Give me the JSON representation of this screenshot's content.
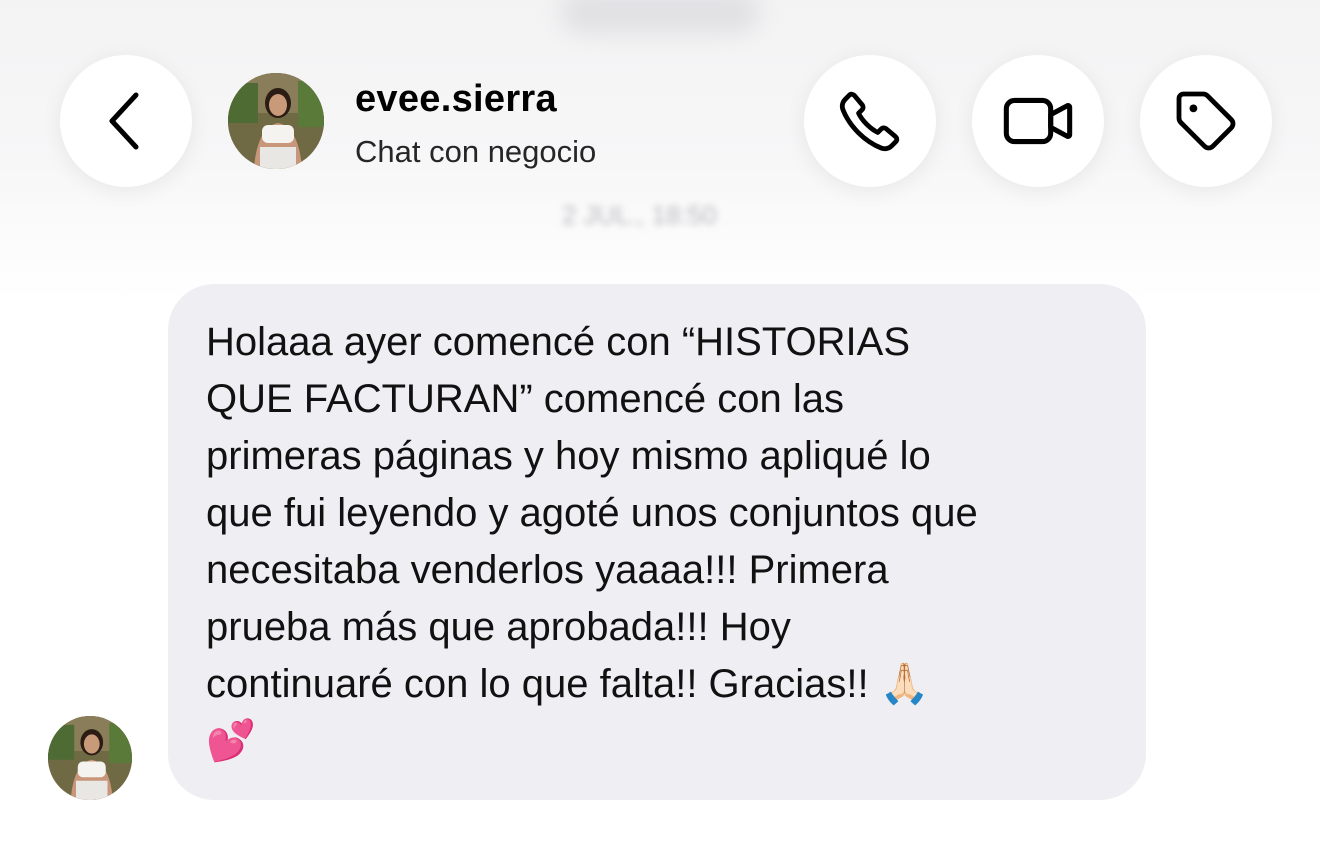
{
  "header": {
    "username": "evee.sierra",
    "subtitle": "Chat con negocio",
    "back_icon": "chevron-left-icon",
    "call_icon": "phone-icon",
    "video_icon": "video-camera-icon",
    "tag_icon": "tag-icon"
  },
  "timestamp": "2 JUL., 18:50",
  "message": {
    "text": "Holaaa ayer comencé con “HISTORIAS\nQUE FACTURAN” comencé con las\nprimeras páginas y hoy mismo apliqué lo\nque fui leyendo y agoté unos conjuntos que\nnecesitaba venderlos yaaaa!!! Primera\nprueba más que aprobada!!! Hoy\ncontinuaré con lo que falta!! Gracias!! 🙏🏻\n💕"
  },
  "colors": {
    "bubble": "#efeff3",
    "text": "#111111",
    "icon": "#000000"
  }
}
